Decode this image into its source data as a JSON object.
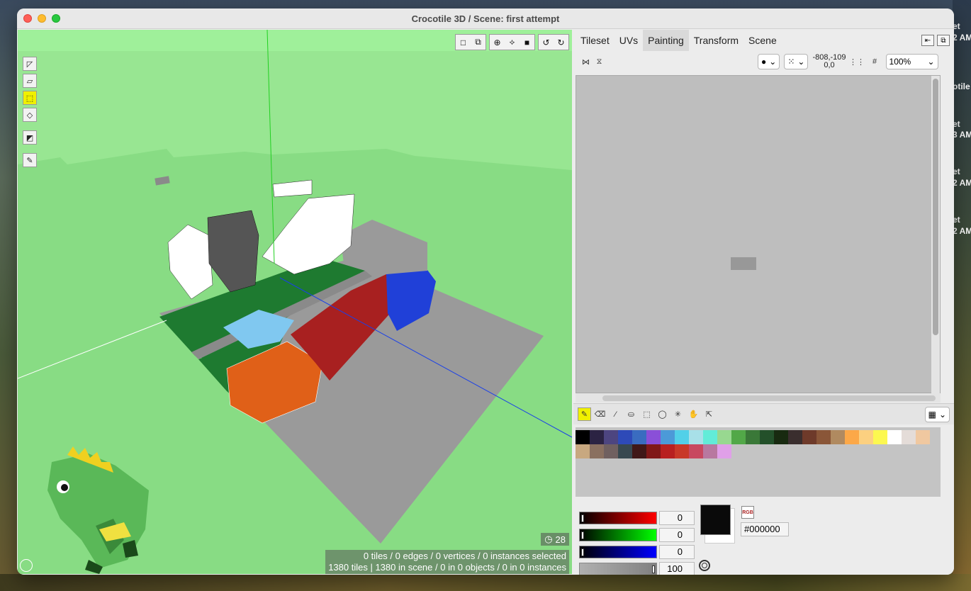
{
  "window": {
    "title": "Crocotile 3D / Scene: first attempt"
  },
  "viewport": {
    "fps": "28",
    "status_line1": "0 tiles / 0 edges / 0 vertices / 0 instances selected",
    "status_line2": "1380 tiles | 1380 in scene / 0 in 0 objects / 0 in 0 instances",
    "left_tools": [
      "vertex-mode-icon",
      "face-mode-icon",
      "tile-mode-icon",
      "edge-mode-icon",
      "select-icon",
      "draw-tool-icon"
    ],
    "top_tools": [
      "single-view-icon",
      "cube-view-icon",
      "snap-icon",
      "rotate-icon",
      "fill-icon",
      "undo-icon",
      "redo-icon"
    ],
    "colors": {
      "background": "#98e692",
      "grid_floor": "#9a9a9a",
      "grass": "#1e7a30",
      "water": "#80c8f0"
    }
  },
  "panel": {
    "tabs": [
      {
        "label": "Tileset",
        "active": false
      },
      {
        "label": "UVs",
        "active": false
      },
      {
        "label": "Painting",
        "active": true
      },
      {
        "label": "Transform",
        "active": false
      },
      {
        "label": "Scene",
        "active": false
      }
    ],
    "coords_line1": "-808,-109",
    "coords_line2": "0,0",
    "zoom": "100%",
    "paint_tools": [
      "pencil-icon",
      "eraser-icon",
      "eyedropper-icon",
      "fill-bucket-icon",
      "rect-select-icon",
      "lasso-icon",
      "magic-wand-icon",
      "hand-icon",
      "move-icon"
    ],
    "palette": [
      "#000000",
      "#2b2343",
      "#4d4580",
      "#2e4ab8",
      "#3a6cc0",
      "#8a4fd8",
      "#4c9ad8",
      "#52d0e8",
      "#a8e0e8",
      "#62ecd8",
      "#98d890",
      "#52a848",
      "#3a7838",
      "#23502a",
      "#182a10",
      "#3a2e2e",
      "#6e3a2a",
      "#8a5638",
      "#b08a60",
      "#fca848",
      "#fcd080",
      "#fcf850",
      "#ffffff",
      "#e4dcd8",
      "#f0c8a0",
      "#c8a880",
      "#8a7060",
      "#706060",
      "#384850",
      "#401818",
      "#801818",
      "#b82020",
      "#c83828",
      "#c84860",
      "#b878a0",
      "#e0a0e8"
    ],
    "color": {
      "r": "0",
      "g": "0",
      "b": "0",
      "alpha": "100",
      "hex": "#000000",
      "rgb_label": "RGB"
    }
  }
}
